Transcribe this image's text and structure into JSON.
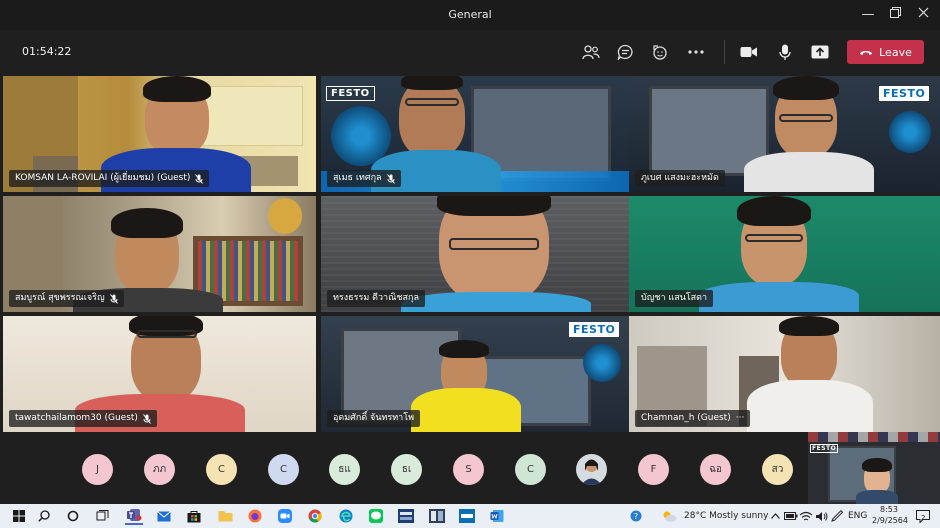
{
  "window": {
    "title": "General"
  },
  "meeting": {
    "timer": "01:54:22",
    "leave_label": "Leave",
    "controls": [
      "people-icon",
      "chat-icon",
      "reactions-icon",
      "more-icon",
      "camera-icon",
      "mic-icon",
      "share-icon"
    ]
  },
  "tiles": [
    {
      "name": "KOMSAN LA-ROVILAI (ผู้เยี่ยมชม) (Guest)",
      "muted": true
    },
    {
      "name": "สุเมธ เทศกุล",
      "muted": true
    },
    {
      "name": "ภูเบศ แสงมะฮะหมัด",
      "muted": false
    },
    {
      "name": "สมบูรณ์ สุขพรรณเจริญ",
      "muted": true
    },
    {
      "name": "ทรงธรรม ดีวาณิชสกุล",
      "muted": false
    },
    {
      "name": "บัญชา แสนโสดา",
      "muted": false
    },
    {
      "name": "tawatchailamom30 (Guest)",
      "muted": true
    },
    {
      "name": "อุดมศักดิ์ จันทรทาโพ",
      "muted": false
    },
    {
      "name": "Chamnan_h (Guest)",
      "muted": false,
      "more": "···"
    }
  ],
  "festo_logo": "FESTO",
  "participants": [
    {
      "initials": "J",
      "color": "#f4c6d0"
    },
    {
      "initials": "ภภ",
      "color": "#f4c6d0"
    },
    {
      "initials": "C",
      "color": "#f6e3b4"
    },
    {
      "initials": "C",
      "color": "#cfd9ef"
    },
    {
      "initials": "ธแ",
      "color": "#d8ecd9"
    },
    {
      "initials": "ธเ",
      "color": "#d8ecd9"
    },
    {
      "initials": "S",
      "color": "#f4c6d0"
    },
    {
      "initials": "C",
      "color": "#cfe6d4"
    },
    {
      "initials": "",
      "color": "#9aa3ad"
    },
    {
      "initials": "F",
      "color": "#f4c6d0"
    },
    {
      "initials": "ฉอ",
      "color": "#f4c6d0"
    },
    {
      "initials": "สว",
      "color": "#f6e3b4"
    }
  ],
  "taskbar": {
    "weather": "28°C  Mostly sunny",
    "language": "ENG",
    "time": "8:53",
    "date": "2/9/2564",
    "notifications": "2"
  },
  "colors": {
    "leave": "#c4314b",
    "accent": "#6264a7"
  }
}
